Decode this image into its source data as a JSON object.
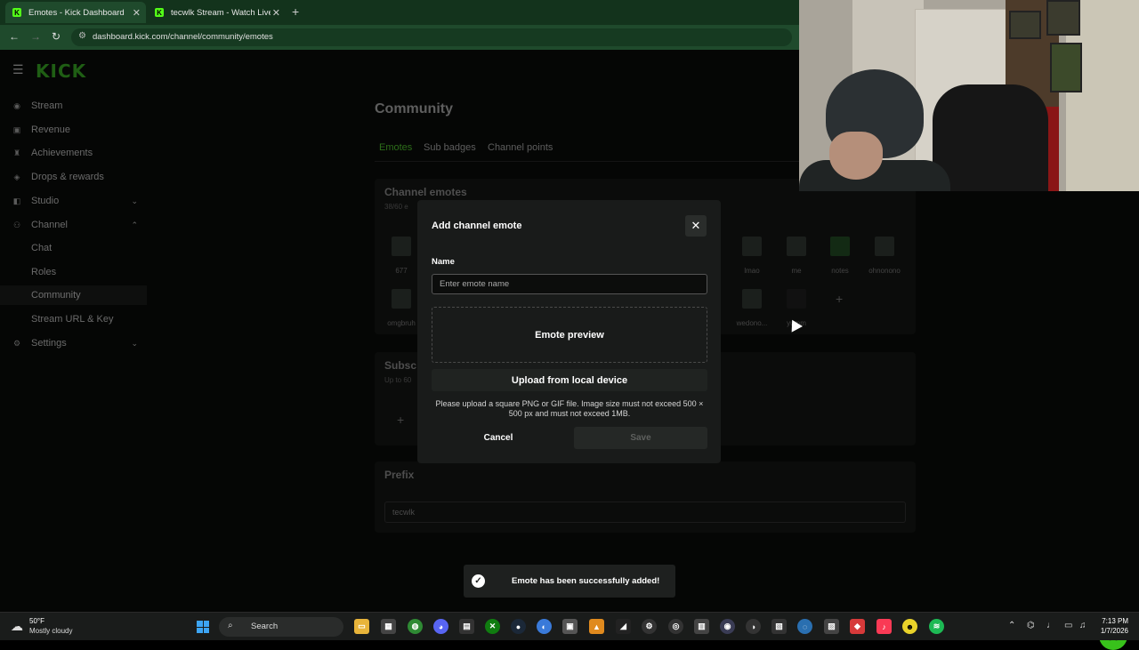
{
  "browser": {
    "tabs": [
      {
        "label": "Emotes - Kick Dashboard",
        "favicon": "K"
      },
      {
        "label": "tecwlk Stream - Watch Live on",
        "favicon": "K"
      }
    ],
    "url": "dashboard.kick.com/channel/community/emotes"
  },
  "sidebar": {
    "logo": "KICK",
    "items": [
      {
        "label": "Stream",
        "icon": "broadcast-icon"
      },
      {
        "label": "Revenue",
        "icon": "dollar-icon"
      },
      {
        "label": "Achievements",
        "icon": "trophy-icon"
      },
      {
        "label": "Drops & rewards",
        "icon": "gift-icon"
      },
      {
        "label": "Studio",
        "icon": "studio-icon"
      },
      {
        "label": "Channel",
        "icon": "channel-icon"
      },
      {
        "label": "Chat"
      },
      {
        "label": "Roles"
      },
      {
        "label": "Community"
      },
      {
        "label": "Stream URL & Key"
      },
      {
        "label": "Settings",
        "icon": "gear-icon"
      }
    ]
  },
  "main": {
    "title": "Community",
    "tabs": [
      "Emotes",
      "Sub badges",
      "Channel points"
    ],
    "channel_emotes": {
      "title": "Channel emotes",
      "count": "38/60 e",
      "emote_labels": [
        "677",
        "lmao",
        "me",
        "notes",
        "ohnonono",
        "omgbruh",
        "wedono...",
        "yumm"
      ]
    },
    "sub_card": {
      "title": "Subsc",
      "sub": "Up to 60"
    },
    "prefix": {
      "title": "Prefix",
      "value": "tecwlk"
    }
  },
  "modal": {
    "title": "Add channel emote",
    "name_label": "Name",
    "name_placeholder": "Enter emote name",
    "preview_label": "Emote preview",
    "upload_label": "Upload from local device",
    "help_text": "Please upload a square PNG or GIF file. Image size must not exceed 500 × 500 px and must not exceed 1MB.",
    "cancel_label": "Cancel",
    "save_label": "Save"
  },
  "toast": {
    "message": "Emote has been successfully added!"
  },
  "taskbar": {
    "weather_temp": "50°F",
    "weather_desc": "Mostly cloudy",
    "search_label": "Search",
    "time": "7:13 PM",
    "date": "1/7/2026"
  },
  "colors": {
    "kick_green": "#53fc18",
    "modal_bg": "#191b1a",
    "page_bg": "#050605"
  }
}
